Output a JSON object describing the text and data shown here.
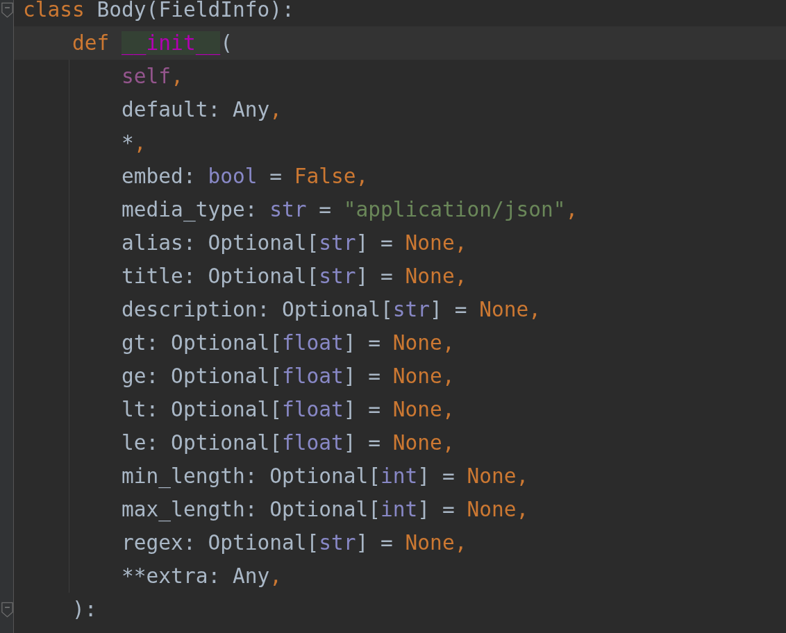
{
  "editor": {
    "lines": [
      {
        "fold_marker": true,
        "current": false,
        "tokens": [
          {
            "text": "class",
            "kind": "keyword"
          },
          {
            "text": " Body(FieldInfo):",
            "kind": "plain"
          }
        ]
      },
      {
        "fold_marker": false,
        "current": true,
        "tokens": [
          {
            "text": "    def ",
            "kind": "keyword"
          },
          {
            "text": "__init__",
            "kind": "magic"
          },
          {
            "text": "(",
            "kind": "plain"
          }
        ]
      },
      {
        "fold_marker": false,
        "current": false,
        "tokens": [
          {
            "text": "        self",
            "kind": "self"
          },
          {
            "text": ",",
            "kind": "punct"
          }
        ]
      },
      {
        "fold_marker": false,
        "current": false,
        "tokens": [
          {
            "text": "        default: Any",
            "kind": "plain"
          },
          {
            "text": ",",
            "kind": "punct"
          }
        ]
      },
      {
        "fold_marker": false,
        "current": false,
        "tokens": [
          {
            "text": "        *",
            "kind": "plain"
          },
          {
            "text": ",",
            "kind": "punct"
          }
        ]
      },
      {
        "fold_marker": false,
        "current": false,
        "tokens": [
          {
            "text": "        embed: ",
            "kind": "plain"
          },
          {
            "text": "bool",
            "kind": "type"
          },
          {
            "text": " = ",
            "kind": "plain"
          },
          {
            "text": "False",
            "kind": "keyword"
          },
          {
            "text": ",",
            "kind": "punct"
          }
        ]
      },
      {
        "fold_marker": false,
        "current": false,
        "tokens": [
          {
            "text": "        media_type: ",
            "kind": "plain"
          },
          {
            "text": "str",
            "kind": "type"
          },
          {
            "text": " = ",
            "kind": "plain"
          },
          {
            "text": "\"application/json\"",
            "kind": "string"
          },
          {
            "text": ",",
            "kind": "punct"
          }
        ]
      },
      {
        "fold_marker": false,
        "current": false,
        "tokens": [
          {
            "text": "        alias: Optional[",
            "kind": "plain"
          },
          {
            "text": "str",
            "kind": "type"
          },
          {
            "text": "] = ",
            "kind": "plain"
          },
          {
            "text": "None",
            "kind": "keyword"
          },
          {
            "text": ",",
            "kind": "punct"
          }
        ]
      },
      {
        "fold_marker": false,
        "current": false,
        "tokens": [
          {
            "text": "        title: Optional[",
            "kind": "plain"
          },
          {
            "text": "str",
            "kind": "type"
          },
          {
            "text": "] = ",
            "kind": "plain"
          },
          {
            "text": "None",
            "kind": "keyword"
          },
          {
            "text": ",",
            "kind": "punct"
          }
        ]
      },
      {
        "fold_marker": false,
        "current": false,
        "tokens": [
          {
            "text": "        description: Optional[",
            "kind": "plain"
          },
          {
            "text": "str",
            "kind": "type"
          },
          {
            "text": "] = ",
            "kind": "plain"
          },
          {
            "text": "None",
            "kind": "keyword"
          },
          {
            "text": ",",
            "kind": "punct"
          }
        ]
      },
      {
        "fold_marker": false,
        "current": false,
        "tokens": [
          {
            "text": "        gt: Optional[",
            "kind": "plain"
          },
          {
            "text": "float",
            "kind": "type"
          },
          {
            "text": "] = ",
            "kind": "plain"
          },
          {
            "text": "None",
            "kind": "keyword"
          },
          {
            "text": ",",
            "kind": "punct"
          }
        ]
      },
      {
        "fold_marker": false,
        "current": false,
        "tokens": [
          {
            "text": "        ge: Optional[",
            "kind": "plain"
          },
          {
            "text": "float",
            "kind": "type"
          },
          {
            "text": "] = ",
            "kind": "plain"
          },
          {
            "text": "None",
            "kind": "keyword"
          },
          {
            "text": ",",
            "kind": "punct"
          }
        ]
      },
      {
        "fold_marker": false,
        "current": false,
        "tokens": [
          {
            "text": "        lt: Optional[",
            "kind": "plain"
          },
          {
            "text": "float",
            "kind": "type"
          },
          {
            "text": "] = ",
            "kind": "plain"
          },
          {
            "text": "None",
            "kind": "keyword"
          },
          {
            "text": ",",
            "kind": "punct"
          }
        ]
      },
      {
        "fold_marker": false,
        "current": false,
        "tokens": [
          {
            "text": "        le: Optional[",
            "kind": "plain"
          },
          {
            "text": "float",
            "kind": "type"
          },
          {
            "text": "] = ",
            "kind": "plain"
          },
          {
            "text": "None",
            "kind": "keyword"
          },
          {
            "text": ",",
            "kind": "punct"
          }
        ]
      },
      {
        "fold_marker": false,
        "current": false,
        "tokens": [
          {
            "text": "        min_length: Optional[",
            "kind": "plain"
          },
          {
            "text": "int",
            "kind": "type"
          },
          {
            "text": "] = ",
            "kind": "plain"
          },
          {
            "text": "None",
            "kind": "keyword"
          },
          {
            "text": ",",
            "kind": "punct"
          }
        ]
      },
      {
        "fold_marker": false,
        "current": false,
        "tokens": [
          {
            "text": "        max_length: Optional[",
            "kind": "plain"
          },
          {
            "text": "int",
            "kind": "type"
          },
          {
            "text": "] = ",
            "kind": "plain"
          },
          {
            "text": "None",
            "kind": "keyword"
          },
          {
            "text": ",",
            "kind": "punct"
          }
        ]
      },
      {
        "fold_marker": false,
        "current": false,
        "tokens": [
          {
            "text": "        regex: Optional[",
            "kind": "plain"
          },
          {
            "text": "str",
            "kind": "type"
          },
          {
            "text": "] = ",
            "kind": "plain"
          },
          {
            "text": "None",
            "kind": "keyword"
          },
          {
            "text": ",",
            "kind": "punct"
          }
        ]
      },
      {
        "fold_marker": false,
        "current": false,
        "tokens": [
          {
            "text": "        **extra: Any",
            "kind": "plain"
          },
          {
            "text": ",",
            "kind": "punct"
          }
        ]
      },
      {
        "fold_marker": true,
        "current": false,
        "tokens": [
          {
            "text": "    ):",
            "kind": "plain"
          }
        ]
      }
    ]
  }
}
